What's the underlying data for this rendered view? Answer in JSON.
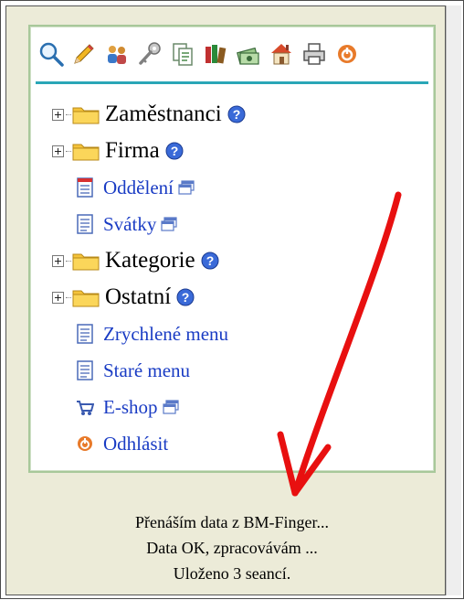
{
  "toolbar": {
    "icons": [
      "search-icon",
      "pencil-icon",
      "users-icon",
      "key-icon",
      "documents-icon",
      "books-icon",
      "money-icon",
      "house-icon",
      "printer-icon",
      "logout-icon"
    ]
  },
  "menu": {
    "items": [
      {
        "label": "Zaměstnanci",
        "kind": "folder"
      },
      {
        "label": "Firma",
        "kind": "folder"
      },
      {
        "label": "Oddělení",
        "kind": "link"
      },
      {
        "label": "Svátky",
        "kind": "link"
      },
      {
        "label": "Kategorie",
        "kind": "folder"
      },
      {
        "label": "Ostatní",
        "kind": "folder"
      },
      {
        "label": "Zrychlené menu",
        "kind": "link"
      },
      {
        "label": "Staré menu",
        "kind": "link"
      },
      {
        "label": "E-shop",
        "kind": "link"
      },
      {
        "label": "Odhlásit",
        "kind": "link"
      }
    ]
  },
  "status": {
    "lines": [
      "Přenáším data z BM-Finger...",
      "Data OK, zpracovávám ...",
      "Uloženo 3 seancí."
    ]
  },
  "colors": {
    "panel_bg": "#ecebd8",
    "menu_border": "#a8c89a",
    "separator": "#2aa6b7",
    "link": "#1a3cc4",
    "annotation_arrow": "#e81010"
  }
}
